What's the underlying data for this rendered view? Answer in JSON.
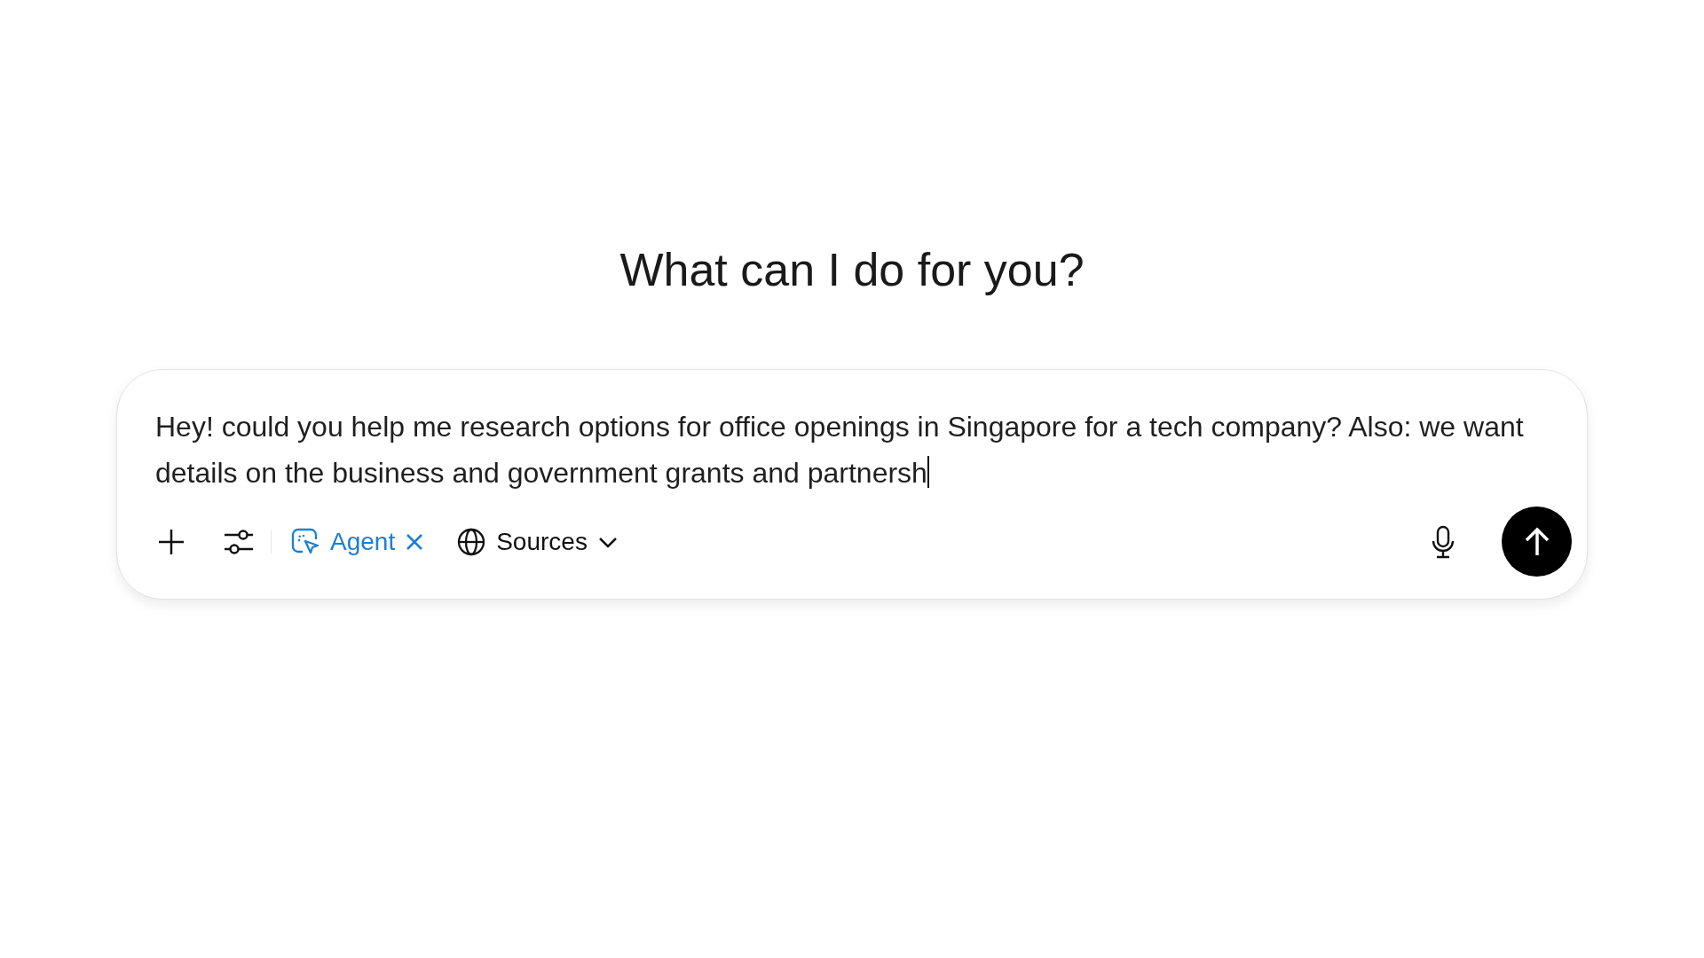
{
  "heading": "What can I do for you?",
  "composer": {
    "value": "Hey! could you help me research options for office openings in Singapore for a tech company? Also: we want details on the business and government grants and partnersh",
    "focused": true
  },
  "agent_chip": {
    "label": "Agent",
    "active": true
  },
  "sources_button": {
    "label": "Sources"
  }
}
